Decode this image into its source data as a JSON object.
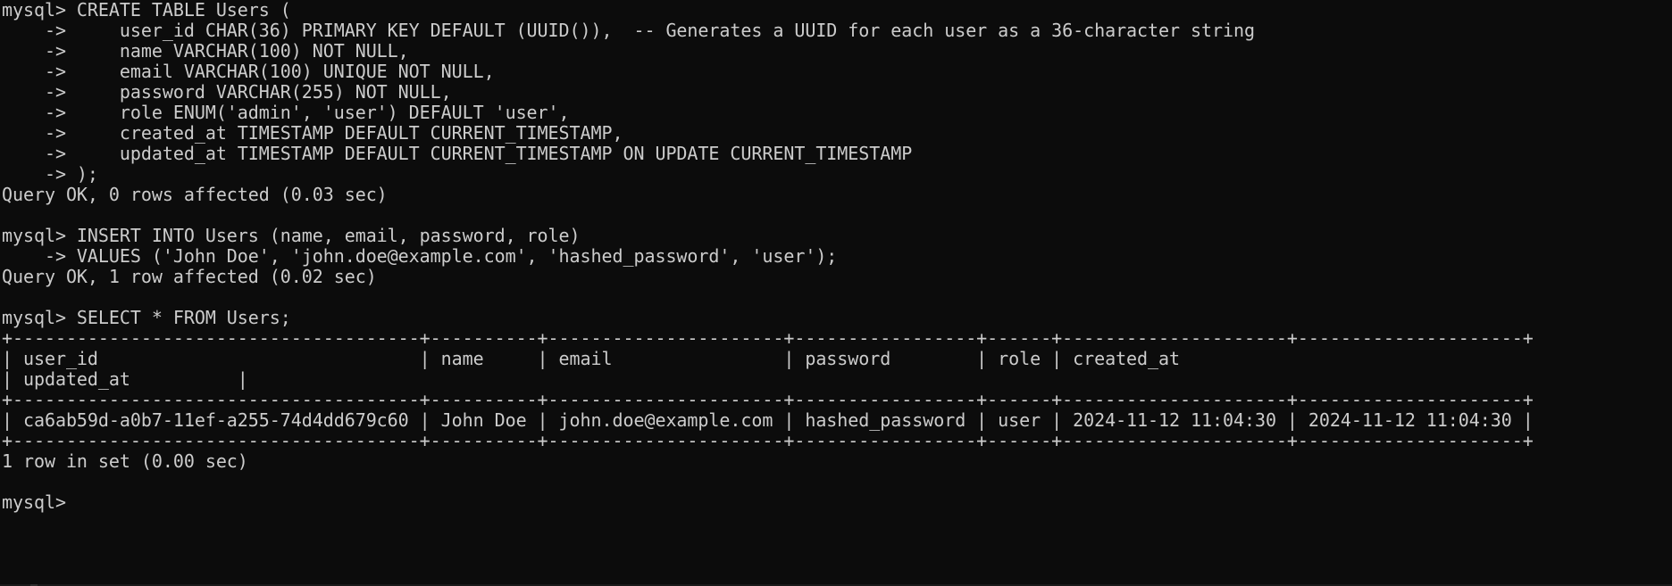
{
  "terminal": {
    "lines": [
      "mysql> CREATE TABLE Users (",
      "    ->     user_id CHAR(36) PRIMARY KEY DEFAULT (UUID()),  -- Generates a UUID for each user as a 36-character string",
      "    ->     name VARCHAR(100) NOT NULL,",
      "    ->     email VARCHAR(100) UNIQUE NOT NULL,",
      "    ->     password VARCHAR(255) NOT NULL,",
      "    ->     role ENUM('admin', 'user') DEFAULT 'user',",
      "    ->     created_at TIMESTAMP DEFAULT CURRENT_TIMESTAMP,",
      "    ->     updated_at TIMESTAMP DEFAULT CURRENT_TIMESTAMP ON UPDATE CURRENT_TIMESTAMP",
      "    -> );",
      "Query OK, 0 rows affected (0.03 sec)",
      "",
      "mysql> INSERT INTO Users (name, email, password, role)",
      "    -> VALUES ('John Doe', 'john.doe@example.com', 'hashed_password', 'user');",
      "Query OK, 1 row affected (0.02 sec)",
      "",
      "mysql> SELECT * FROM Users;",
      "+--------------------------------------+----------+----------------------+-----------------+------+---------------------+---------------------+",
      "| user_id                              | name     | email                | password        | role | created_at          ",
      "| updated_at          |",
      "+--------------------------------------+----------+----------------------+-----------------+------+---------------------+---------------------+",
      "| ca6ab59d-a0b7-11ef-a255-74d4dd679c60 | John Doe | john.doe@example.com | hashed_password | user | 2024-11-12 11:04:30 | 2024-11-12 11:04:30 |",
      "+--------------------------------------+----------+----------------------+-----------------+------+---------------------+---------------------+",
      "1 row in set (0.00 sec)",
      "",
      "mysql> "
    ]
  },
  "colors": {
    "background": "#0c0c0c",
    "foreground": "#cccccc"
  }
}
